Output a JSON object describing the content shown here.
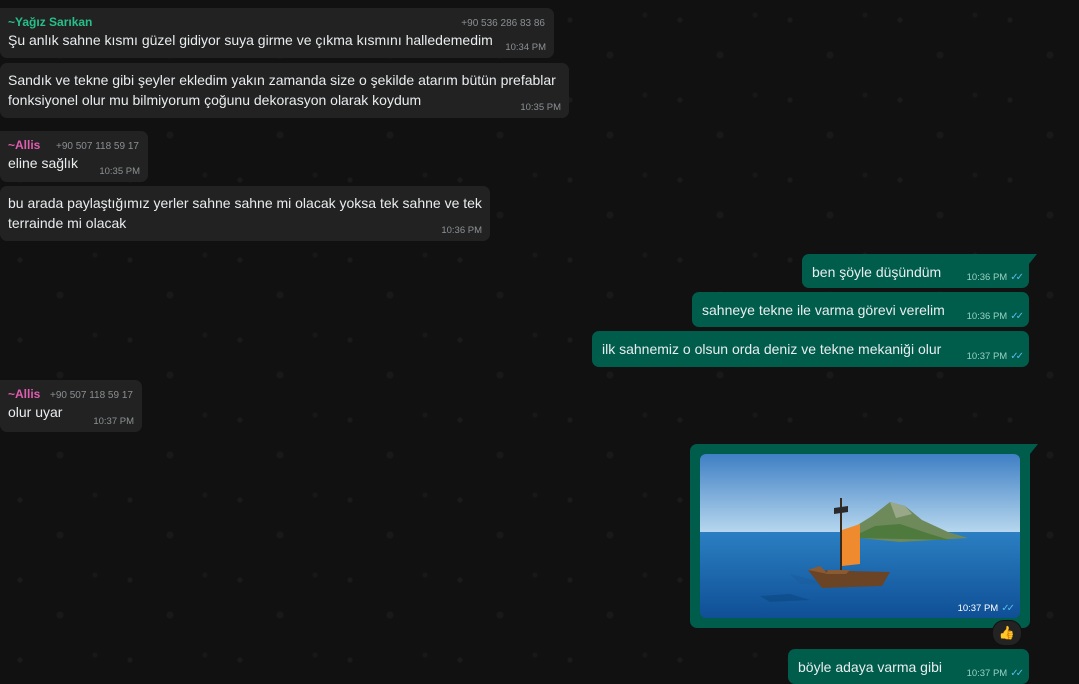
{
  "messages": {
    "m1": {
      "sender": "~Yağız Sarıkan",
      "phone": "+90 536 286 83 86",
      "text": "Şu anlık sahne kısmı güzel gidiyor suya girme ve çıkma kısmını halledemedim",
      "time": "10:34 PM"
    },
    "m2": {
      "line1": "Sandık ve tekne gibi şeyler ekledim yakın zamanda size o şekilde atarım bütün prefablar",
      "line2": "fonksiyonel olur mu bilmiyorum çoğunu dekorasyon olarak koydum",
      "time": "10:35 PM"
    },
    "m3": {
      "sender": "~Allis",
      "phone": "+90 507 118 59 17",
      "text": "eline sağlık",
      "time": "10:35 PM"
    },
    "m4": {
      "line1": "bu arada paylaştığımız yerler sahne sahne mi olacak yoksa tek sahne ve tek",
      "line2": "terrainde mi olacak",
      "time": "10:36 PM"
    },
    "m5": {
      "text": "ben şöyle düşündüm",
      "time": "10:36 PM"
    },
    "m6": {
      "text": "sahneye tekne ile varma görevi verelim",
      "time": "10:36 PM"
    },
    "m7": {
      "text": "ilk sahnemiz o olsun orda deniz ve tekne mekaniği olur",
      "time": "10:37 PM"
    },
    "m8": {
      "sender": "~Allis",
      "phone": "+90 507 118 59 17",
      "text": "olur uyar",
      "time": "10:37 PM"
    },
    "m9": {
      "time": "10:37 PM",
      "reaction": "👍",
      "image_desc_icon": "boat-island-scene"
    },
    "m10": {
      "text": "böyle adaya varma gibi",
      "time": "10:37 PM"
    }
  },
  "colors": {
    "incoming_bubble": "#222222",
    "outgoing_bubble": "#005c4b",
    "sender_yagiz": "#25c08a",
    "sender_allis": "#e05db0",
    "read_ticks": "#53bdeb"
  },
  "ticks": "✓✓"
}
